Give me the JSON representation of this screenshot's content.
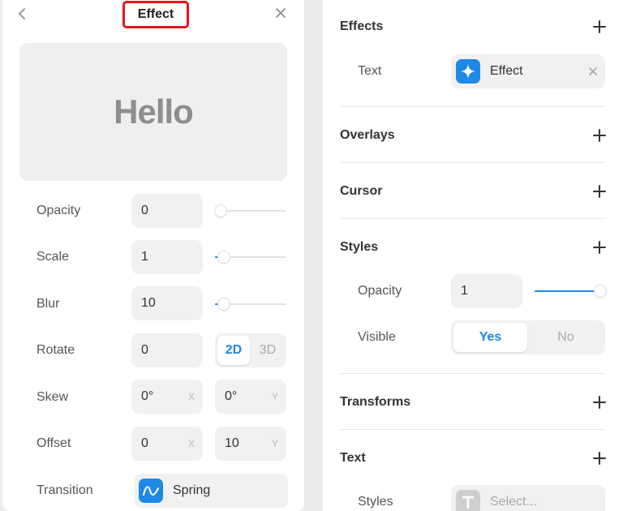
{
  "effect_panel": {
    "title": "Effect",
    "back_icon": "chevron-left-icon",
    "close_icon": "close-icon",
    "preview_text": "Hello",
    "opacity": {
      "label": "Opacity",
      "value": "0",
      "slider_fraction": 0
    },
    "scale": {
      "label": "Scale",
      "value": "1",
      "slider_fraction": 0.05
    },
    "blur": {
      "label": "Blur",
      "value": "10",
      "slider_fraction": 0.05
    },
    "rotate": {
      "label": "Rotate",
      "value": "0",
      "modes": [
        "2D",
        "3D"
      ],
      "active_mode": "2D"
    },
    "skew": {
      "label": "Skew",
      "x_value": "0°",
      "x_axis": "X",
      "y_value": "0°",
      "y_axis": "Y"
    },
    "offset": {
      "label": "Offset",
      "x_value": "0",
      "x_axis": "X",
      "y_value": "10",
      "y_axis": "Y"
    },
    "transition": {
      "label": "Transition",
      "value": "Spring",
      "icon": "spring-curve-icon"
    }
  },
  "properties_panel": {
    "effects": {
      "title": "Effects",
      "text_label": "Text",
      "chip_label": "Effect",
      "chip_icon": "sparkle-icon"
    },
    "overlays": {
      "title": "Overlays"
    },
    "cursor": {
      "title": "Cursor"
    },
    "styles": {
      "title": "Styles",
      "opacity_label": "Opacity",
      "opacity_value": "1",
      "opacity_fraction": 1,
      "visible_label": "Visible",
      "visible_options": [
        "Yes",
        "No"
      ],
      "visible_active": "Yes"
    },
    "transforms": {
      "title": "Transforms"
    },
    "text": {
      "title": "Text",
      "styles_label": "Styles",
      "select_placeholder": "Select...",
      "select_icon": "text-style-icon"
    }
  },
  "colors": {
    "accent": "#1e88e5",
    "highlight": "#e8141c"
  }
}
